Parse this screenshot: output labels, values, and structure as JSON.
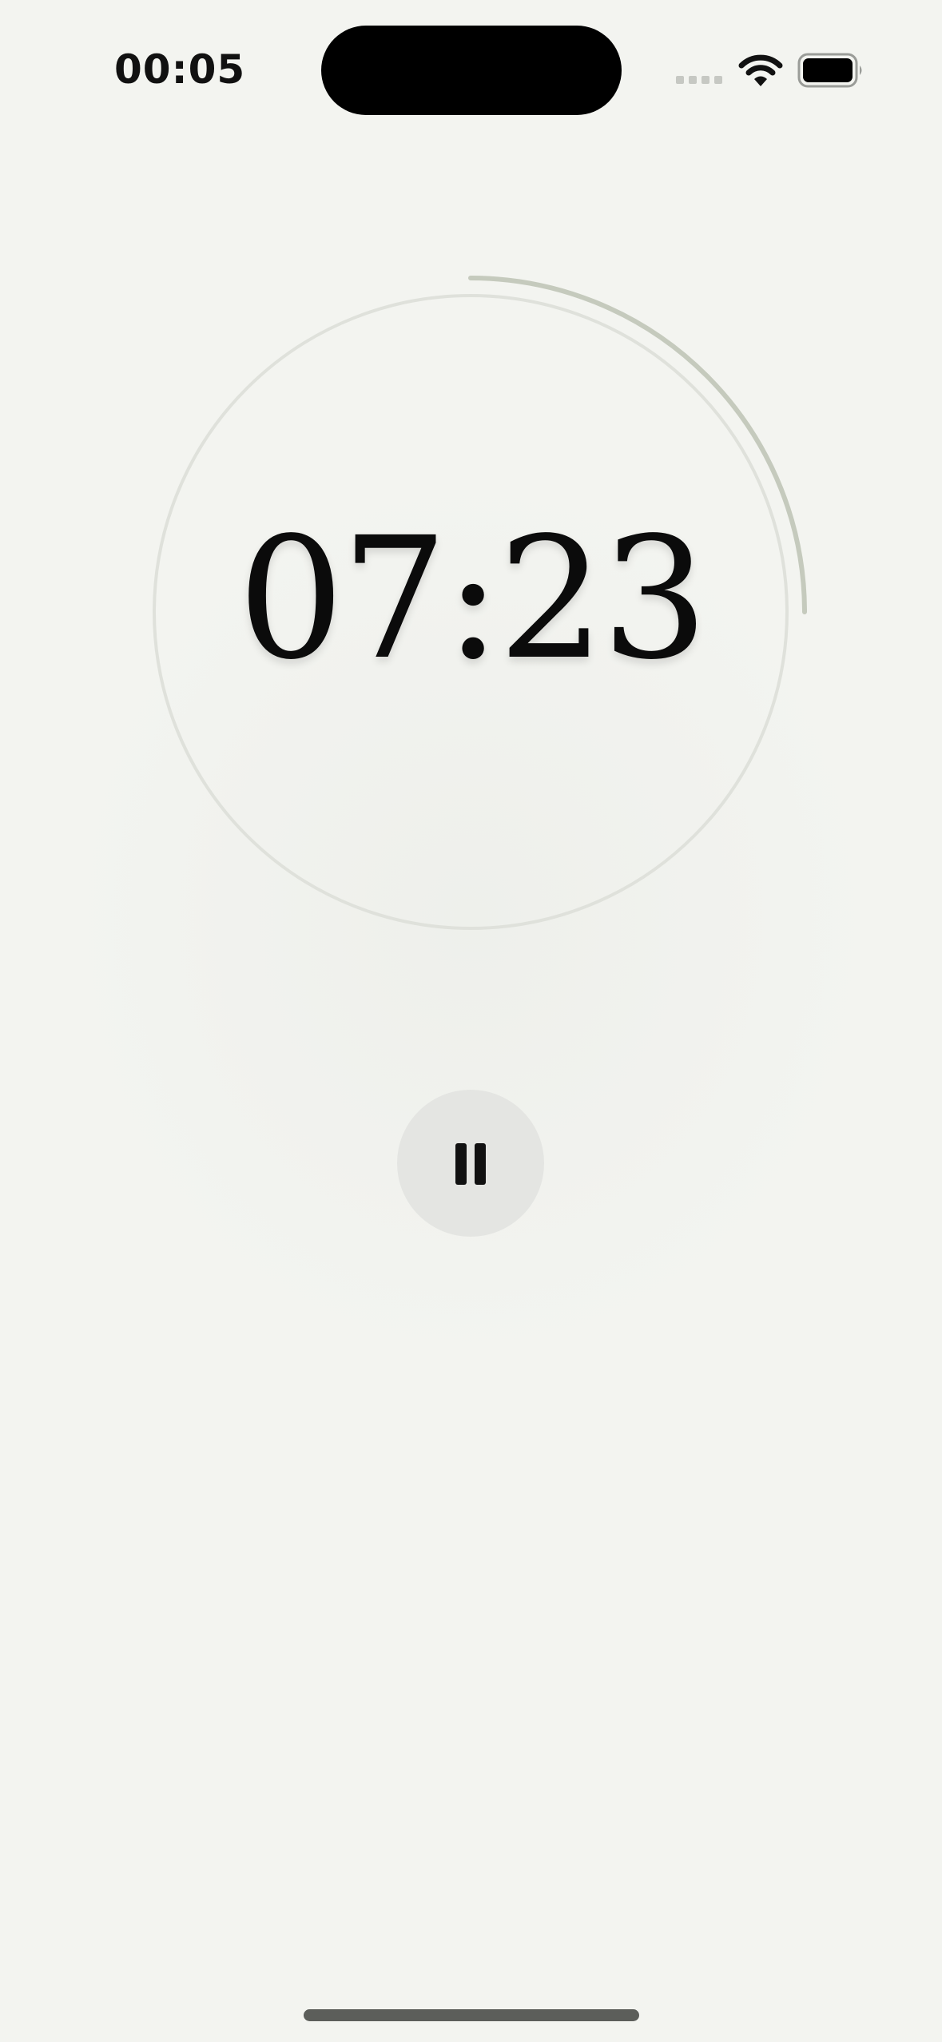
{
  "status_bar": {
    "time": "00:05",
    "icons": [
      "cellular-signal-icon",
      "wifi-icon",
      "battery-icon"
    ]
  },
  "timer": {
    "display": "07:23",
    "progress_fraction": 0.25
  },
  "controls": {
    "pause_icon": "pause-icon"
  },
  "colors": {
    "background": "#f3f4f0",
    "ring_track": "#dfe1db",
    "ring_progress": "#c5cabd",
    "button": "#e4e5e2",
    "text": "#0b0b0b"
  }
}
